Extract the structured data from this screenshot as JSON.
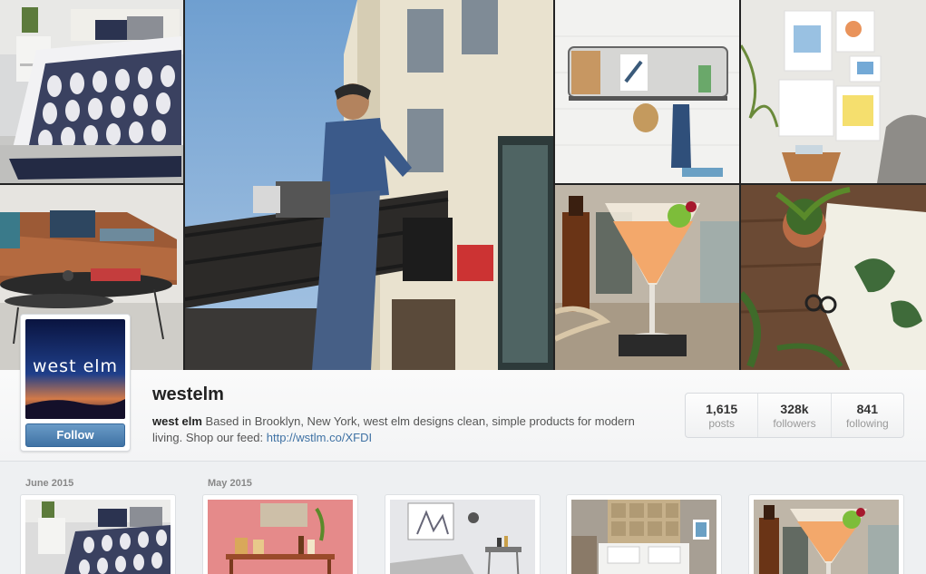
{
  "profile": {
    "username": "westelm",
    "avatar_text": "west elm",
    "follow_label": "Follow",
    "bio_name": "west elm",
    "bio_text": "Based in Brooklyn, New York, west elm designs clean, simple products for modern living. Shop our feed:",
    "bio_link": "http://wstlm.co/XFDI"
  },
  "stats": [
    {
      "value": "1,615",
      "label": "posts"
    },
    {
      "value": "328k",
      "label": "followers"
    },
    {
      "value": "841",
      "label": "following"
    }
  ],
  "feed": {
    "months": [
      "June 2015",
      "May 2015"
    ]
  },
  "colors": {
    "link": "#3f72a4",
    "follow_button": "#4f82b3"
  }
}
